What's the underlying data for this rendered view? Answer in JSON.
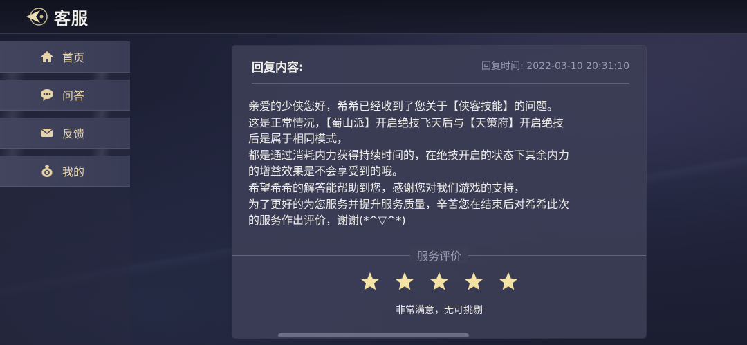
{
  "header": {
    "title": "客服",
    "back_icon": "back-arrow-icon"
  },
  "sidebar": {
    "items": [
      {
        "label": "首页",
        "icon": "home-icon"
      },
      {
        "label": "问答",
        "icon": "chat-bubble-icon"
      },
      {
        "label": "反馈",
        "icon": "mail-icon"
      },
      {
        "label": "我的",
        "icon": "user-bag-icon"
      }
    ],
    "label_color": "#e6d3a8"
  },
  "reply": {
    "heading": "回复内容:",
    "time": "回复时间: 2022-03-10 20:31:10",
    "lines": [
      "亲爱的少侠您好，希希已经收到了您关于【侠客技能】的问题。",
      "这是正常情况，【蜀山派】开启绝技飞天后与【天策府】开启绝技",
      "后是属于相同模式，",
      "都是通过消耗内力获得持续时间的，在绝技开启的状态下其余内力",
      "的增益效果是不会享受到的哦。",
      "希望希希的解答能帮助到您，感谢您对我们游戏的支持，",
      "为了更好的为您服务并提升服务质量，辛苦您在结束后对希希此次",
      "的服务作出评价，谢谢(*^▽^*)"
    ]
  },
  "rating": {
    "title": "服务评价",
    "stars": 5,
    "max_stars": 5,
    "text": "非常满意，无可挑剔",
    "star_color": "#f3e2a4"
  }
}
